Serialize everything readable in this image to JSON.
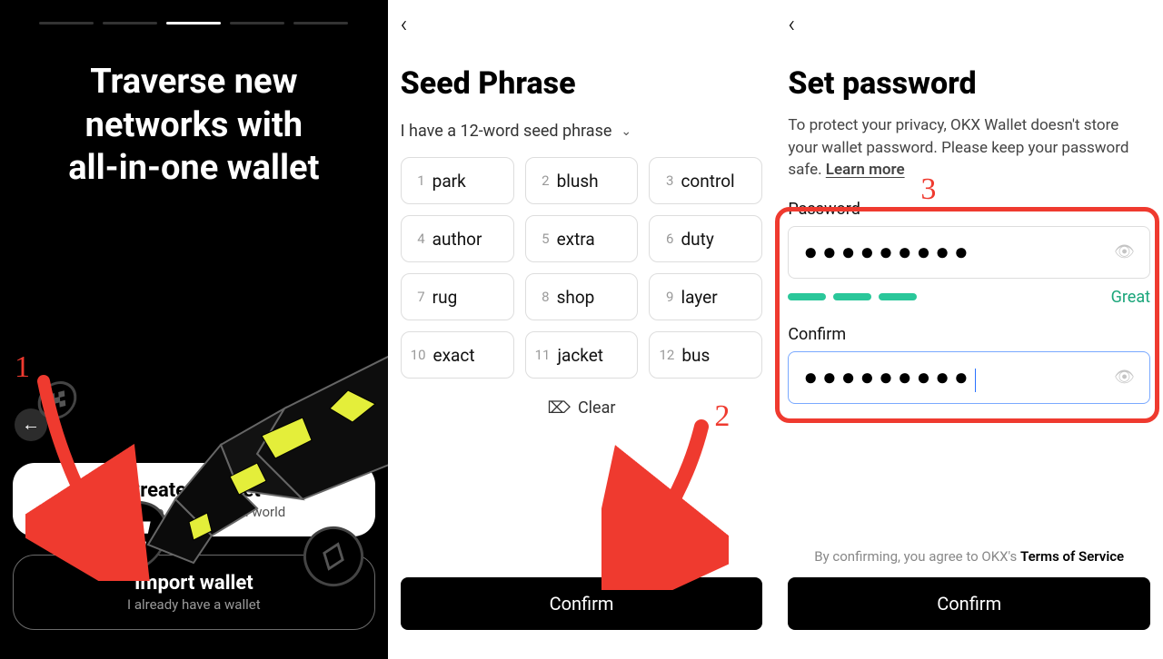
{
  "pane1": {
    "headline_line1": "Traverse new",
    "headline_line2": "networks with",
    "headline_line3": "all-in-one wallet",
    "create_button": {
      "title": "Create a wallet",
      "subtitle": "I'm new to decentralized world"
    },
    "import_button": {
      "title": "Import wallet",
      "subtitle": "I already have a wallet"
    }
  },
  "pane2": {
    "title": "Seed Phrase",
    "dropdown_label": "I have a 12-word seed phrase",
    "words": [
      "park",
      "blush",
      "control",
      "author",
      "extra",
      "duty",
      "rug",
      "shop",
      "layer",
      "exact",
      "jacket",
      "bus"
    ],
    "clear_label": "Clear",
    "confirm_label": "Confirm"
  },
  "pane3": {
    "title": "Set password",
    "subtext": "To protect your privacy, OKX Wallet doesn't store your wallet password. Please keep your password safe.  ",
    "learn_more": "Learn more",
    "password_label": "Password",
    "password_mask": "●●●●●●●●●",
    "strength_label": "Great",
    "confirm_label": "Confirm",
    "confirm_mask": "●●●●●●●●●",
    "terms_prefix": "By confirming, you agree to OKX's ",
    "terms_link": "Terms of Service",
    "confirm_button": "Confirm"
  },
  "annotations": {
    "n1": "1",
    "n2": "2",
    "n3": "3"
  }
}
